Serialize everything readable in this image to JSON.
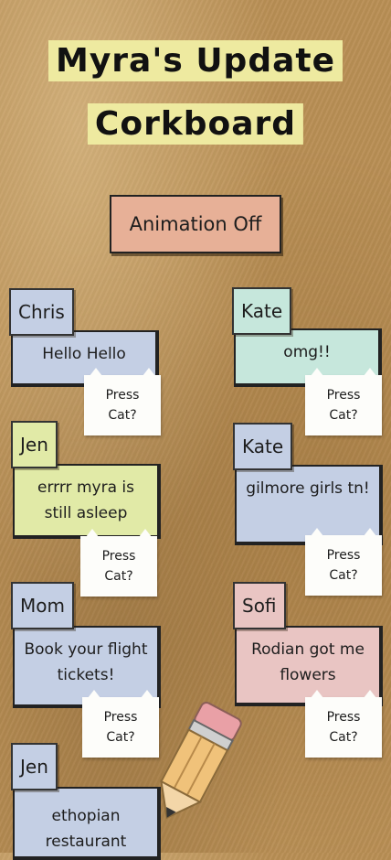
{
  "header": {
    "title_line1": "Myra's Update",
    "title_line2": "Corkboard"
  },
  "controls": {
    "animation_toggle_label": "Animation Off"
  },
  "cat_label": {
    "line1": "Press",
    "line2": "Cat?"
  },
  "notes": [
    {
      "author": "Chris",
      "message": "Hello Hello",
      "color": "#c4cfe4"
    },
    {
      "author": "Kate",
      "message": "omg!!",
      "color": "#c6e7dc"
    },
    {
      "author": "Jen",
      "message": "errrr myra is still asleep",
      "color": "#e1eaa7"
    },
    {
      "author": "Kate",
      "message": "gilmore girls tn!",
      "color": "#c4cfe4"
    },
    {
      "author": "Mom",
      "message": "Book your flight tickets!",
      "color": "#c4cfe4"
    },
    {
      "author": "Sofi",
      "message": "Rodian got me flowers",
      "color": "#e9c5c3"
    },
    {
      "author": "Jen",
      "message": "ethopian restaurant",
      "color": "#c4cfe4"
    }
  ],
  "icons": {
    "pencil": "pencil-icon",
    "cat": "cat-icon"
  }
}
